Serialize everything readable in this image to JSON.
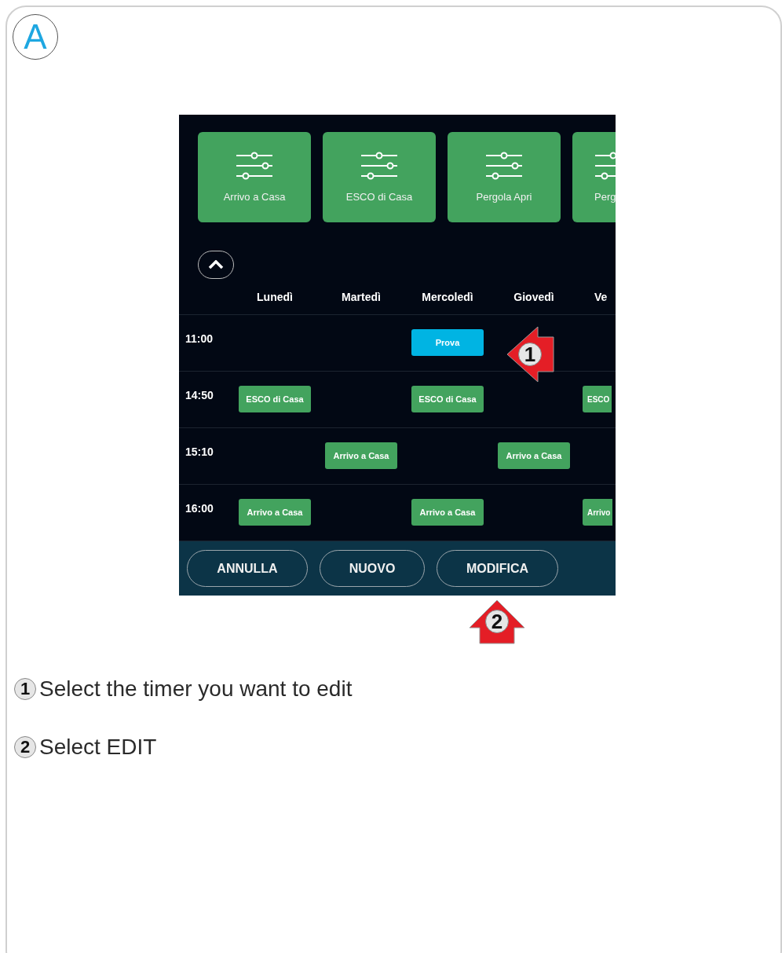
{
  "badge": "A",
  "app": {
    "scenes": [
      {
        "label": "Arrivo a Casa"
      },
      {
        "label": "ESCO di Casa"
      },
      {
        "label": "Pergola Apri"
      },
      {
        "label": "Perg"
      }
    ],
    "days": [
      "Lunedì",
      "Martedì",
      "Mercoledì",
      "Giovedì",
      "Ve"
    ],
    "rows": [
      {
        "time": "11:00",
        "cells": [
          null,
          null,
          {
            "label": "Prova",
            "selected": true
          },
          null,
          null
        ]
      },
      {
        "time": "14:50",
        "cells": [
          {
            "label": "ESCO di Casa",
            "selected": false
          },
          null,
          {
            "label": "ESCO di Casa",
            "selected": false
          },
          null,
          {
            "label": "ESCO",
            "selected": false
          }
        ]
      },
      {
        "time": "15:10",
        "cells": [
          null,
          {
            "label": "Arrivo a Casa",
            "selected": false
          },
          null,
          {
            "label": "Arrivo a Casa",
            "selected": false
          },
          null
        ]
      },
      {
        "time": "16:00",
        "cells": [
          {
            "label": "Arrivo a Casa",
            "selected": false
          },
          null,
          {
            "label": "Arrivo a Casa",
            "selected": false
          },
          null,
          {
            "label": "Arrivo",
            "selected": false
          }
        ]
      }
    ],
    "buttons": [
      {
        "label": "ANNULLA"
      },
      {
        "label": "NUOVO"
      },
      {
        "label": "MODIFICA"
      }
    ]
  },
  "callouts": [
    {
      "number": "1",
      "kind": "left"
    },
    {
      "number": "2",
      "kind": "up"
    }
  ],
  "steps": [
    {
      "number": "1",
      "text": "Select the timer you want to edit"
    },
    {
      "number": "2",
      "text": "Select EDIT"
    }
  ]
}
